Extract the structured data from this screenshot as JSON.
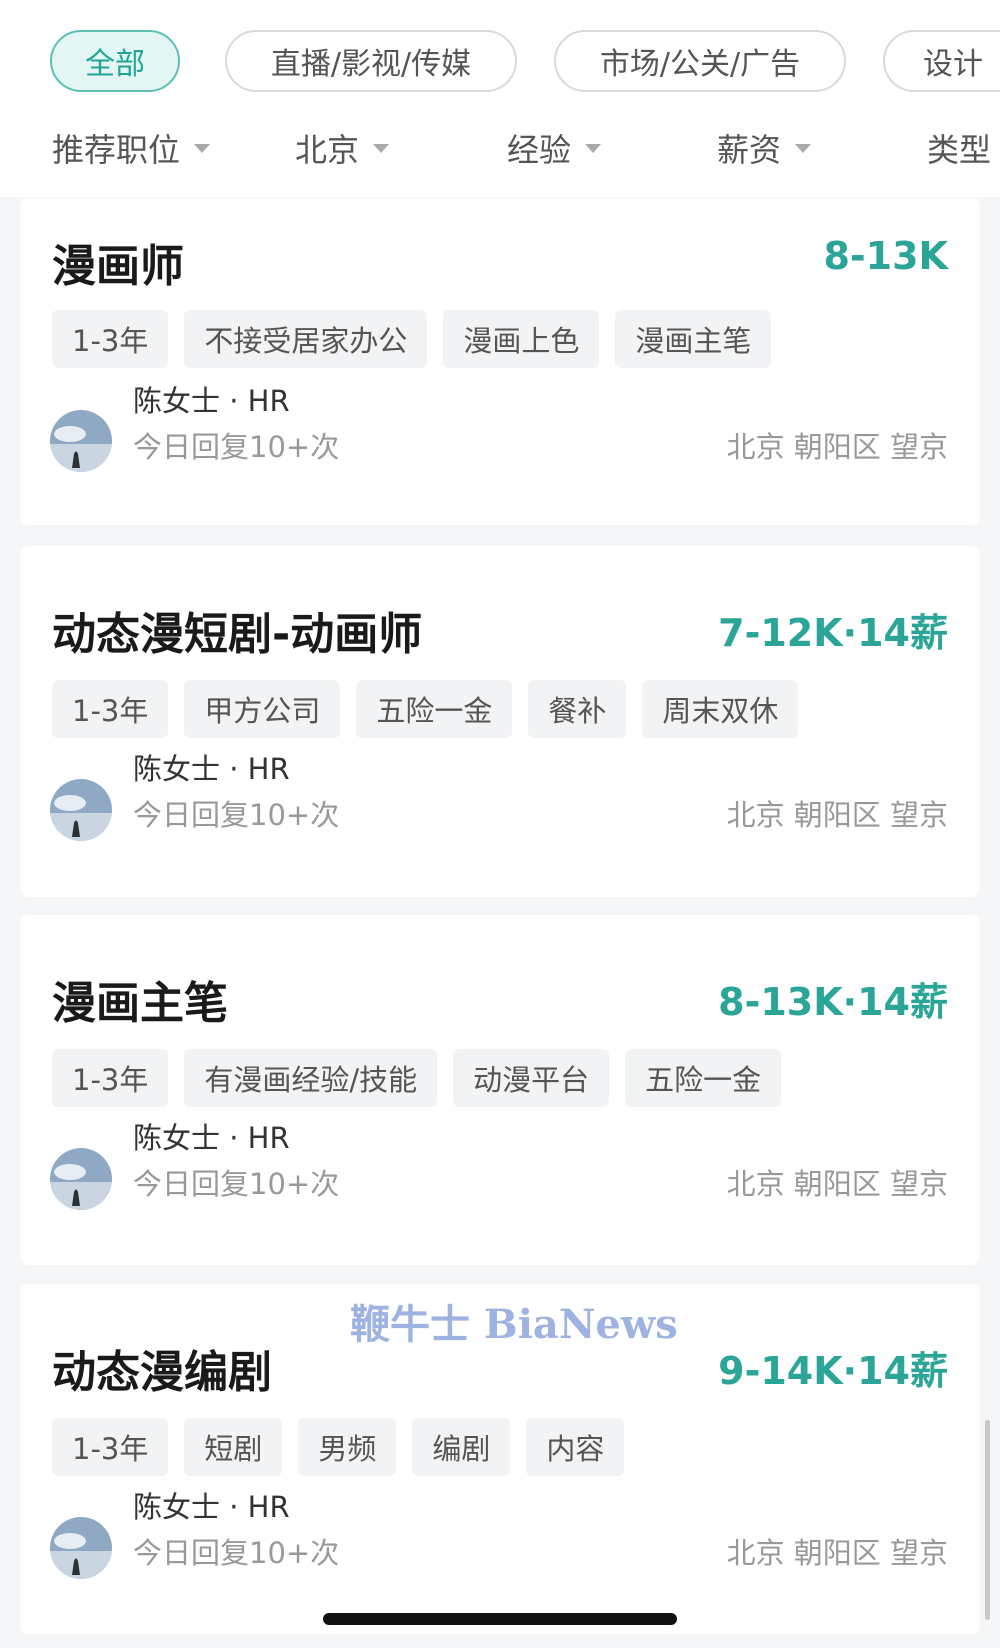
{
  "categories": [
    "全部",
    "直播/影视/传媒",
    "市场/公关/广告",
    "设计"
  ],
  "filters": [
    "推荐职位",
    "北京",
    "经验",
    "薪资",
    "类型"
  ],
  "jobs": [
    {
      "title": "漫画师",
      "salary": "8-13K",
      "tags": [
        "1-3年",
        "不接受居家办公",
        "漫画上色",
        "漫画主笔"
      ],
      "hr_name": "陈女士 · HR",
      "reply": "今日回复10+次",
      "location": "北京 朝阳区 望京"
    },
    {
      "title": "动态漫短剧-动画师",
      "salary": "7-12K·14薪",
      "tags": [
        "1-3年",
        "甲方公司",
        "五险一金",
        "餐补",
        "周末双休"
      ],
      "hr_name": "陈女士 · HR",
      "reply": "今日回复10+次",
      "location": "北京 朝阳区 望京"
    },
    {
      "title": "漫画主笔",
      "salary": "8-13K·14薪",
      "tags": [
        "1-3年",
        "有漫画经验/技能",
        "动漫平台",
        "五险一金"
      ],
      "hr_name": "陈女士 · HR",
      "reply": "今日回复10+次",
      "location": "北京 朝阳区 望京"
    },
    {
      "title": "动态漫编剧",
      "salary": "9-14K·14薪",
      "tags": [
        "1-3年",
        "短剧",
        "男频",
        "编剧",
        "内容"
      ],
      "hr_name": "陈女士 · HR",
      "reply": "今日回复10+次",
      "location": "北京 朝阳区 望京"
    }
  ],
  "watermark": "鞭牛士 BiaNews",
  "colors": {
    "accent": "#2aa597",
    "active_chip_bg": "#e3f6f4",
    "tag_bg": "#f2f3f4",
    "page_bg": "#f5f6f7"
  }
}
